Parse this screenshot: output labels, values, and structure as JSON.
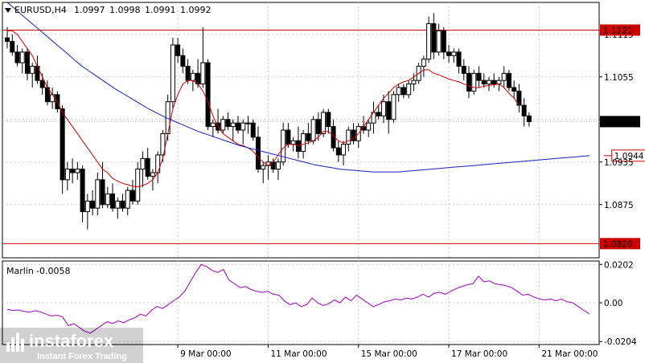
{
  "header": {
    "symbol": "EURUSD,H4",
    "open": "1.0997",
    "high": "1.0998",
    "low": "1.0991",
    "close": "1.0992"
  },
  "price_scale": {
    "ticks": [
      "1.1115",
      "1.1055",
      "1.0995",
      "1.0935",
      "1.0875"
    ],
    "tick_values": [
      1.1115,
      1.1055,
      1.0995,
      1.0935,
      1.0875
    ],
    "range": [
      1.08,
      1.116
    ]
  },
  "levels": {
    "upper": {
      "label": "1.1121",
      "value": 1.1121,
      "color": "#d00000"
    },
    "lower": {
      "label": "1.0820",
      "value": 1.082,
      "color": "#d00000"
    },
    "current": {
      "label": "1.0992",
      "value": 1.0992
    },
    "ma_target": {
      "label": "1.0944",
      "value": 1.0944,
      "color": "#d00000"
    }
  },
  "indicator": {
    "name": "Marlin",
    "value": "-0.0058",
    "ticks": [
      "0.0202",
      "0.00",
      "-0.0204"
    ],
    "tick_values": [
      0.0202,
      0.0,
      -0.0204
    ],
    "range": [
      -0.022,
      0.022
    ],
    "color": "#a000c0"
  },
  "time_axis": {
    "labels": [
      "9 Mar 00:00",
      "11 Mar 00:00",
      "15 Mar 00:00",
      "17 Mar 00:00",
      "21 Mar 00:00"
    ],
    "label_bar_index": [
      34,
      52,
      70,
      88,
      106
    ],
    "bars": 117
  },
  "watermark": {
    "brand": "instaforex",
    "tagline": "Instant Forex Trading"
  },
  "colors": {
    "bull": "#ffffff",
    "bear": "#000000",
    "fast_ma": "#d00000",
    "slow_ma": "#1020c0",
    "marlin": "#a000c0"
  },
  "chart_data": {
    "type": "candlestick",
    "title": "EURUSD,H4",
    "ylim": [
      1.08,
      1.116
    ],
    "candles": [
      [
        1.111,
        1.1125,
        1.1095,
        1.1105
      ],
      [
        1.1105,
        1.1115,
        1.1085,
        1.109
      ],
      [
        1.109,
        1.11,
        1.107,
        1.1075
      ],
      [
        1.1075,
        1.1095,
        1.106,
        1.109
      ],
      [
        1.109,
        1.1095,
        1.105,
        1.106
      ],
      [
        1.106,
        1.1075,
        1.104,
        1.107
      ],
      [
        1.107,
        1.1085,
        1.1045,
        1.105
      ],
      [
        1.105,
        1.106,
        1.103,
        1.104
      ],
      [
        1.104,
        1.105,
        1.1015,
        1.102
      ],
      [
        1.102,
        1.104,
        1.101,
        1.103
      ],
      [
        1.103,
        1.1035,
        1.1005,
        1.101
      ],
      [
        1.101,
        1.1015,
        1.089,
        1.091
      ],
      [
        1.091,
        1.0935,
        1.0895,
        1.0925
      ],
      [
        1.0925,
        1.094,
        1.0905,
        1.092
      ],
      [
        1.092,
        1.0935,
        1.091,
        1.0925
      ],
      [
        1.0925,
        1.093,
        1.085,
        1.0865
      ],
      [
        1.0865,
        1.089,
        1.084,
        1.088
      ],
      [
        1.088,
        1.0895,
        1.086,
        1.087
      ],
      [
        1.087,
        1.092,
        1.086,
        1.091
      ],
      [
        1.091,
        1.0935,
        1.087,
        1.0875
      ],
      [
        1.0875,
        1.09,
        1.087,
        1.089
      ],
      [
        1.089,
        1.0905,
        1.0865,
        1.087
      ],
      [
        1.087,
        1.0885,
        1.0855,
        1.088
      ],
      [
        1.088,
        1.089,
        1.0865,
        1.087
      ],
      [
        1.087,
        1.09,
        1.086,
        1.0895
      ],
      [
        1.0895,
        1.091,
        1.0875,
        1.088
      ],
      [
        1.088,
        1.0935,
        1.0875,
        1.0925
      ],
      [
        1.0925,
        1.095,
        1.09,
        1.094
      ],
      [
        1.094,
        1.0955,
        1.091,
        1.0915
      ],
      [
        1.0915,
        1.0925,
        1.0895,
        1.092
      ],
      [
        1.092,
        1.095,
        1.0905,
        1.0945
      ],
      [
        1.0945,
        1.098,
        1.0935,
        1.0975
      ],
      [
        1.0975,
        1.103,
        1.0965,
        1.102
      ],
      [
        1.102,
        1.111,
        1.101,
        1.11
      ],
      [
        1.11,
        1.111,
        1.1075,
        1.1085
      ],
      [
        1.1085,
        1.1095,
        1.106,
        1.107
      ],
      [
        1.107,
        1.108,
        1.1045,
        1.105
      ],
      [
        1.105,
        1.1065,
        1.1035,
        1.106
      ],
      [
        1.106,
        1.108,
        1.104,
        1.1045
      ],
      [
        1.1045,
        1.1125,
        1.104,
        1.1075
      ],
      [
        1.1075,
        1.108,
        1.098,
        1.0985
      ],
      [
        1.0985,
        1.0995,
        1.097,
        1.099
      ],
      [
        1.099,
        1.101,
        1.0975,
        1.098
      ],
      [
        1.098,
        1.1,
        1.0975,
        1.0995
      ],
      [
        1.0995,
        1.1005,
        1.098,
        1.0985
      ],
      [
        1.0985,
        1.0995,
        1.0965,
        1.099
      ],
      [
        1.099,
        1.1,
        1.0975,
        1.098
      ],
      [
        1.098,
        1.0995,
        1.096,
        1.099
      ],
      [
        1.099,
        1.1,
        1.0975,
        1.099
      ],
      [
        1.099,
        1.0995,
        1.0965,
        1.097
      ],
      [
        1.097,
        1.0985,
        1.092,
        1.0925
      ],
      [
        1.0925,
        1.0935,
        1.0905,
        1.093
      ],
      [
        1.093,
        1.0945,
        1.091,
        1.0935
      ],
      [
        1.0935,
        1.094,
        1.092,
        1.0925
      ],
      [
        1.0925,
        1.094,
        1.091,
        1.0935
      ],
      [
        1.0935,
        1.099,
        1.093,
        1.098
      ],
      [
        1.098,
        1.099,
        1.0955,
        1.096
      ],
      [
        1.096,
        1.097,
        1.095,
        1.0965
      ],
      [
        1.0965,
        1.0985,
        1.094,
        1.095
      ],
      [
        1.095,
        1.098,
        1.094,
        1.0975
      ],
      [
        1.0975,
        1.099,
        1.096,
        1.0965
      ],
      [
        1.0965,
        1.1,
        1.096,
        1.0995
      ],
      [
        1.0995,
        1.1005,
        1.0965,
        1.0975
      ],
      [
        1.0975,
        1.101,
        1.097,
        1.1005
      ],
      [
        1.1005,
        1.101,
        1.0975,
        1.0985
      ],
      [
        1.0985,
        1.0995,
        1.095,
        1.0955
      ],
      [
        1.0955,
        1.0965,
        1.0935,
        1.0945
      ],
      [
        1.0945,
        1.0965,
        1.093,
        1.096
      ],
      [
        1.096,
        1.0985,
        1.095,
        1.098
      ],
      [
        1.098,
        1.099,
        1.096,
        1.0965
      ],
      [
        1.0965,
        1.099,
        1.0955,
        1.0985
      ],
      [
        1.0985,
        1.1,
        1.0975,
        1.098
      ],
      [
        1.098,
        1.0995,
        1.097,
        1.099
      ],
      [
        1.099,
        1.102,
        1.0975,
        1.1005
      ],
      [
        1.1005,
        1.1015,
        1.0995,
        1.1
      ],
      [
        1.1,
        1.103,
        1.099,
        1.102
      ],
      [
        1.102,
        1.1035,
        1.0975,
        1.0995
      ],
      [
        1.0995,
        1.1035,
        1.099,
        1.103
      ],
      [
        1.103,
        1.1045,
        1.102,
        1.104
      ],
      [
        1.104,
        1.1045,
        1.1025,
        1.103
      ],
      [
        1.103,
        1.105,
        1.1025,
        1.1045
      ],
      [
        1.1045,
        1.106,
        1.1035,
        1.105
      ],
      [
        1.105,
        1.1075,
        1.1045,
        1.107
      ],
      [
        1.107,
        1.1085,
        1.1055,
        1.108
      ],
      [
        1.108,
        1.114,
        1.1075,
        1.113
      ],
      [
        1.113,
        1.1145,
        1.108,
        1.109
      ],
      [
        1.109,
        1.113,
        1.1085,
        1.112
      ],
      [
        1.112,
        1.1125,
        1.108,
        1.109
      ],
      [
        1.109,
        1.11,
        1.1075,
        1.1085
      ],
      [
        1.1085,
        1.1095,
        1.1075,
        1.109
      ],
      [
        1.109,
        1.1095,
        1.106,
        1.107
      ],
      [
        1.107,
        1.108,
        1.105,
        1.106
      ],
      [
        1.106,
        1.107,
        1.1025,
        1.1035
      ],
      [
        1.1035,
        1.1065,
        1.103,
        1.106
      ],
      [
        1.106,
        1.107,
        1.104,
        1.105
      ],
      [
        1.105,
        1.106,
        1.104,
        1.1045
      ],
      [
        1.1045,
        1.1055,
        1.1035,
        1.105
      ],
      [
        1.105,
        1.106,
        1.104,
        1.1045
      ],
      [
        1.1045,
        1.1055,
        1.1035,
        1.105
      ],
      [
        1.105,
        1.107,
        1.104,
        1.106
      ],
      [
        1.106,
        1.1065,
        1.1035,
        1.104
      ],
      [
        1.104,
        1.105,
        1.1025,
        1.1035
      ],
      [
        1.1035,
        1.1045,
        1.1005,
        1.1015
      ],
      [
        1.1015,
        1.1025,
        1.0985,
        1.1
      ],
      [
        1.1,
        1.1005,
        1.0985,
        1.0992
      ]
    ],
    "fast_ma": [
      1.112,
      1.112,
      1.1115,
      1.1105,
      1.1095,
      1.1085,
      1.107,
      1.1055,
      1.104,
      1.103,
      1.102,
      1.1005,
      1.0995,
      1.0985,
      1.0975,
      1.0965,
      1.0955,
      1.0945,
      1.0935,
      1.0925,
      1.092,
      1.0912,
      1.0908,
      1.0905,
      1.0903,
      1.0901,
      1.09,
      1.0902,
      1.0905,
      1.091,
      1.092,
      1.094,
      1.0975,
      1.101,
      1.103,
      1.1045,
      1.105,
      1.105,
      1.1045,
      1.1035,
      1.102,
      1.1,
      1.0985,
      1.0975,
      1.097,
      1.0965,
      1.096,
      1.0958,
      1.0955,
      1.095,
      1.0942,
      1.0935,
      1.093,
      1.0935,
      1.0945,
      1.0955,
      1.096,
      1.096,
      1.0958,
      1.096,
      1.0962,
      1.0965,
      1.097,
      1.0978,
      1.0978,
      1.0972,
      1.0965,
      1.0962,
      1.0965,
      1.0968,
      1.0975,
      1.0985,
      1.0995,
      1.1005,
      1.1015,
      1.1025,
      1.1032,
      1.104,
      1.1045,
      1.1048,
      1.105,
      1.1055,
      1.106,
      1.1065,
      1.1065,
      1.106,
      1.1058,
      1.1055,
      1.1052,
      1.105,
      1.1048,
      1.1045,
      1.1042,
      1.104,
      1.104,
      1.1042,
      1.1043,
      1.1044,
      1.1045,
      1.104,
      1.1032,
      1.1025,
      1.1015
    ],
    "slow_ma": [
      1.116,
      1.115,
      1.114,
      1.113,
      1.112,
      1.111,
      1.11,
      1.109,
      1.108,
      1.107,
      1.1062,
      1.1054,
      1.1046,
      1.1038,
      1.1031,
      1.1024,
      1.1017,
      1.101,
      1.1004,
      1.0998,
      1.0993,
      1.0988,
      1.0983,
      1.0978,
      1.0974,
      1.097,
      1.0966,
      1.0962,
      1.0958,
      1.0955,
      1.0952,
      1.0949,
      1.0946,
      1.0943,
      1.094,
      1.0937,
      1.0934,
      1.0931,
      1.0929,
      1.0927,
      1.0925,
      1.0924,
      1.0923,
      1.0922,
      1.0921,
      1.0921,
      1.0921,
      1.0921,
      1.0922,
      1.0923,
      1.0924,
      1.0925,
      1.0926,
      1.0927,
      1.0928,
      1.0929,
      1.093,
      1.0931,
      1.0932,
      1.0933,
      1.0934,
      1.0935,
      1.0936,
      1.0937,
      1.0938,
      1.0939,
      1.094,
      1.0941,
      1.0942,
      1.0943,
      1.0944
    ],
    "slow_ma_start_index": 0,
    "marlin": [
      -0.0035,
      -0.004,
      -0.0038,
      -0.0045,
      -0.005,
      -0.0042,
      -0.0048,
      -0.006,
      -0.007,
      -0.0065,
      -0.0075,
      -0.012,
      -0.011,
      -0.013,
      -0.015,
      -0.016,
      -0.014,
      -0.012,
      -0.01,
      -0.011,
      -0.0095,
      -0.0105,
      -0.009,
      -0.008,
      -0.006,
      -0.007,
      -0.004,
      -0.002,
      -0.003,
      -0.001,
      0.001,
      0.003,
      0.006,
      0.011,
      0.016,
      0.0202,
      0.019,
      0.017,
      0.016,
      0.0175,
      0.012,
      0.01,
      0.008,
      0.0085,
      0.007,
      0.006,
      0.0055,
      0.006,
      0.0045,
      0.004,
      0.001,
      -0.001,
      0.0,
      -0.002,
      -0.001,
      0.0025,
      0.0,
      -0.0015,
      -0.0005,
      0.0015,
      0.0,
      0.003,
      0.001,
      0.004,
      0.002,
      0.0,
      -0.002,
      -0.001,
      0.0005,
      0.001,
      0.002,
      0.0015,
      0.0025,
      0.002,
      0.003,
      0.0045,
      0.003,
      0.005,
      0.0055,
      0.0045,
      0.006,
      0.0075,
      0.0085,
      0.0095,
      0.01,
      0.014,
      0.011,
      0.0115,
      0.01,
      0.0095,
      0.009,
      0.008,
      0.006,
      0.004,
      0.0045,
      0.003,
      0.002,
      0.0015,
      0.002,
      0.001,
      0.002,
      0.0005,
      0.0,
      -0.002,
      -0.004,
      -0.0058
    ]
  }
}
